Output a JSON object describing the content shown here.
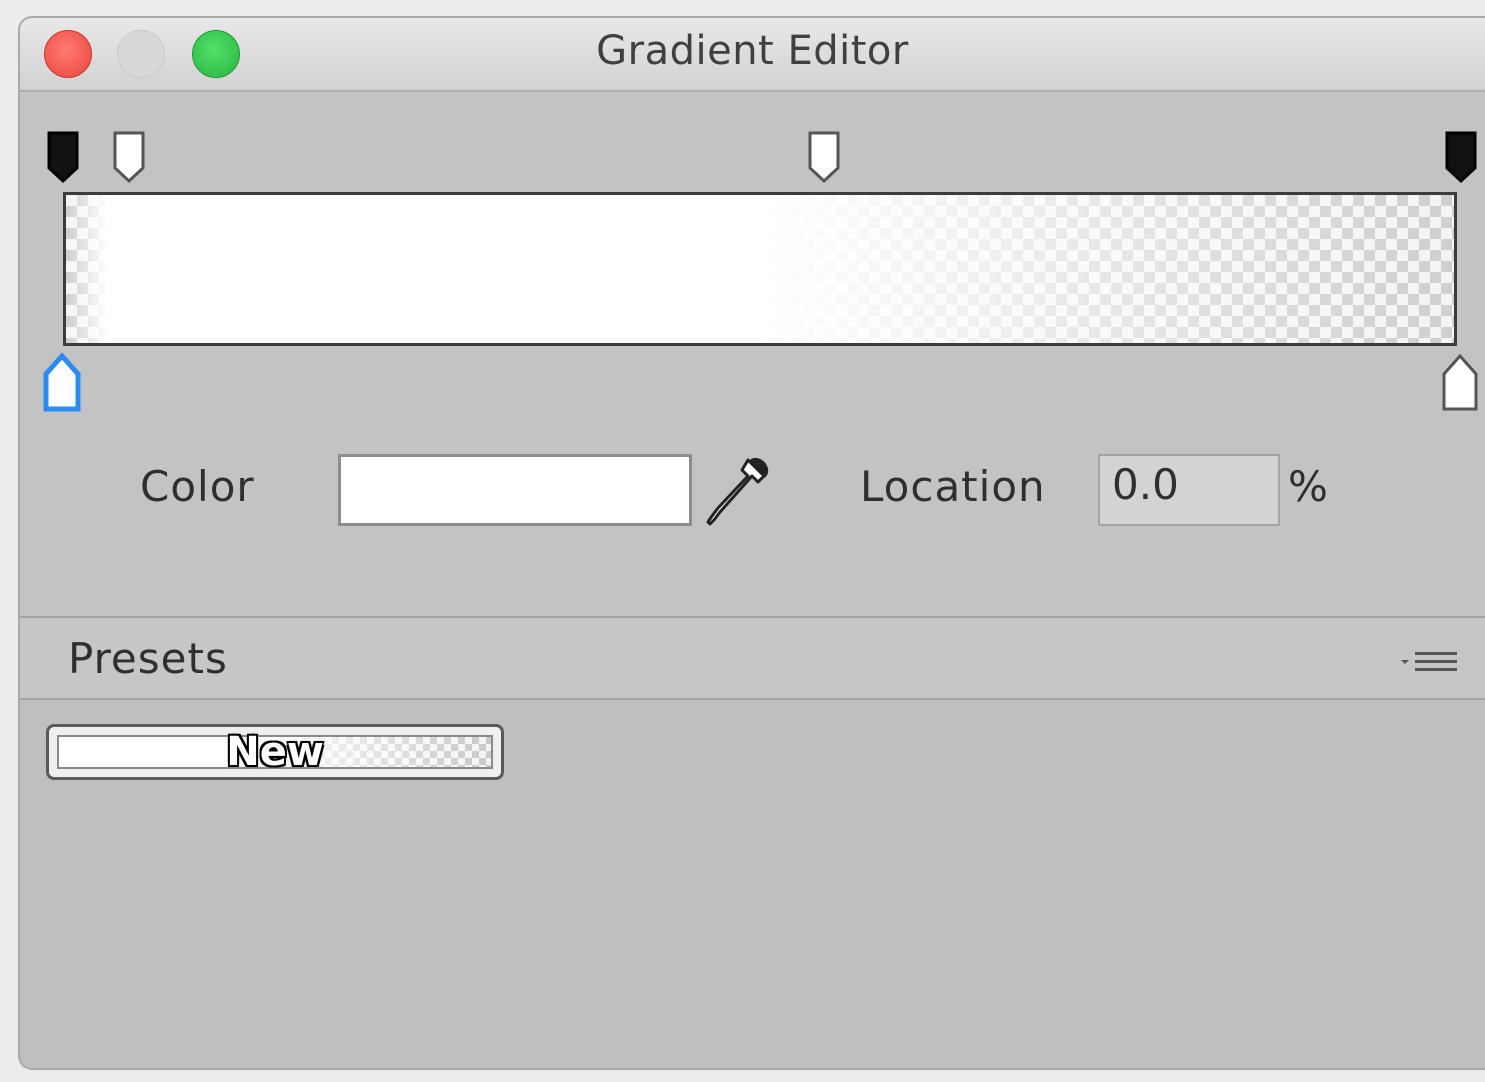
{
  "window": {
    "title": "Gradient Editor"
  },
  "icons": {
    "close": "close-dot",
    "minimize": "minimize-dot",
    "zoom": "zoom-dot",
    "eyedropper": "eyedropper-icon",
    "presets_menu": "menu-list-icon"
  },
  "gradient": {
    "alpha_stops": [
      {
        "color": "#000000",
        "location": 0
      },
      {
        "color": "#ffffff",
        "location": 5
      },
      {
        "color": "#ffffff",
        "location": 55
      },
      {
        "color": "#000000",
        "location": 100
      }
    ],
    "color_stops": [
      {
        "color": "#ffffff",
        "location": 0,
        "selected": true
      },
      {
        "color": "#ffffff",
        "location": 100,
        "selected": false
      }
    ]
  },
  "editor": {
    "color_label": "Color",
    "color_value": "#ffffff",
    "location_label": "Location",
    "location_value": "0.0",
    "location_unit": "%"
  },
  "presets": {
    "heading": "Presets",
    "items": [
      {
        "label": "New"
      }
    ]
  },
  "colors": {
    "close": "#ed5049",
    "zoom": "#2fc046",
    "selected_stop": "#2a8cf0"
  }
}
